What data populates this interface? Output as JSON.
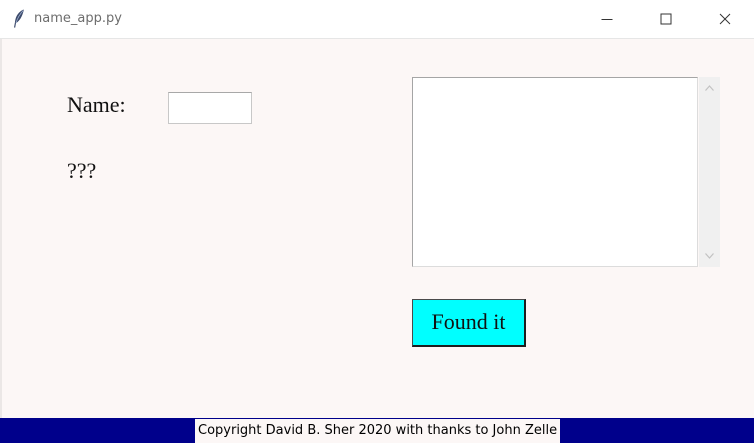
{
  "window": {
    "title": "name_app.py",
    "icon": "feather-icon"
  },
  "form": {
    "name_label": "Name:",
    "name_value": "",
    "result_text": "???",
    "textbox_content": "",
    "button_label": "Found it",
    "button_color": "#00ffff"
  },
  "footer": {
    "text": "Copyright David B. Sher 2020 with thanks to John Zelle",
    "background_color": "#00008b"
  },
  "colors": {
    "client_background": "#fcf7f6"
  }
}
